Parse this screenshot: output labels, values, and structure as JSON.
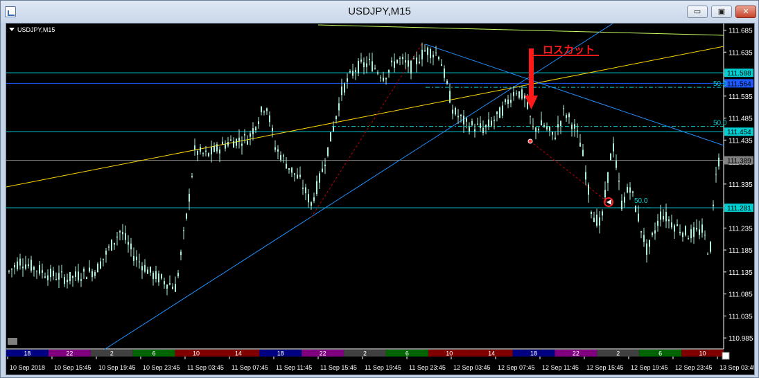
{
  "window": {
    "title": "USDJPY,M15",
    "minimize_label": "▭",
    "restore_label": "▣",
    "close_label": "✕"
  },
  "chart_data": {
    "type": "candlestick",
    "symbol_label": "USDJPY,M15",
    "ylim": [
      110.96,
      111.7
    ],
    "y_ticks": [
      111.685,
      111.635,
      111.585,
      111.535,
      111.485,
      111.435,
      111.385,
      111.335,
      111.285,
      111.235,
      111.185,
      111.135,
      111.085,
      111.035,
      110.985
    ],
    "y_tick_labels": [
      "111.685",
      "111.635",
      "111.585",
      "111.535",
      "111.485",
      "111.435",
      "111.385",
      "111.335",
      "111.285",
      "111.235",
      "111.185",
      "111.135",
      "111.085",
      "111.035",
      "110.985"
    ],
    "x_labels": [
      "10 Sep 2018",
      "10 Sep 15:45",
      "10 Sep 19:45",
      "10 Sep 23:45",
      "11 Sep 03:45",
      "11 Sep 07:45",
      "11 Sep 11:45",
      "11 Sep 15:45",
      "11 Sep 19:45",
      "11 Sep 23:45",
      "12 Sep 03:45",
      "12 Sep 07:45",
      "12 Sep 11:45",
      "12 Sep 15:45",
      "12 Sep 19:45",
      "12 Sep 23:45",
      "13 Sep 03:45"
    ],
    "horizontal_lines": [
      {
        "value": 111.588,
        "label": "111.588",
        "color": "#00ced1"
      },
      {
        "value": 111.564,
        "label": "111.564",
        "color": "#1e5bff"
      },
      {
        "value": 111.454,
        "label": "111.454",
        "color": "#00ced1"
      },
      {
        "value": 111.389,
        "label": "111.389",
        "color": "#808080"
      },
      {
        "value": 111.281,
        "label": "111.281",
        "color": "#00ced1"
      }
    ],
    "fib_labels": [
      {
        "text": "50.0",
        "value": 111.555
      },
      {
        "text": "50.0",
        "value": 111.466
      },
      {
        "text": "50.0",
        "value": 111.292
      }
    ],
    "annotation": {
      "text": "ロスカット",
      "color": "#ff1a1a"
    },
    "session_bar": [
      {
        "label": "18",
        "color": "#000080"
      },
      {
        "label": "22",
        "color": "#800080"
      },
      {
        "label": "2",
        "color": "#404040"
      },
      {
        "label": "6",
        "color": "#006400"
      },
      {
        "label": "10",
        "color": "#800000"
      },
      {
        "label": "14",
        "color": "#800000"
      },
      {
        "label": "18",
        "color": "#000080"
      },
      {
        "label": "22",
        "color": "#800080"
      },
      {
        "label": "2",
        "color": "#404040"
      },
      {
        "label": "6",
        "color": "#006400"
      },
      {
        "label": "10",
        "color": "#800000"
      },
      {
        "label": "14",
        "color": "#800000"
      },
      {
        "label": "18",
        "color": "#000080"
      },
      {
        "label": "22",
        "color": "#800080"
      },
      {
        "label": "2",
        "color": "#404040"
      },
      {
        "label": "6",
        "color": "#006400"
      },
      {
        "label": "10",
        "color": "#800000"
      }
    ],
    "colors": {
      "background": "#000000",
      "candle": "#b0f0d8",
      "axis_text": "#ffffff"
    }
  }
}
